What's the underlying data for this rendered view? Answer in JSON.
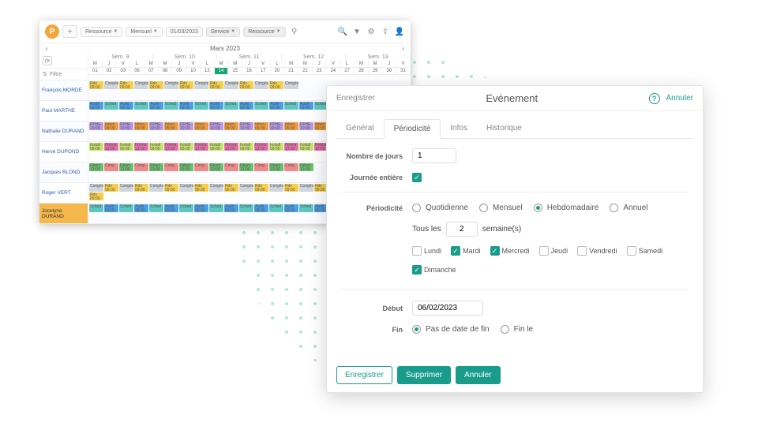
{
  "toolbar": {
    "add": "＋",
    "resource": "Ressource",
    "view": "Mensuel",
    "date": "01/03/2023",
    "service": "Service",
    "resource2": "Ressource"
  },
  "calendar": {
    "month": "Mars 2023",
    "filter": "Filtre",
    "weeks": [
      "Sem. 9",
      "Sem. 10",
      "Sem. 11",
      "Sem. 12",
      "Sem. 13"
    ],
    "dayletters": [
      "M",
      "J",
      "V",
      "L",
      "M",
      "M",
      "J",
      "V",
      "L",
      "M",
      "M",
      "J",
      "V",
      "L",
      "M",
      "M",
      "J",
      "V",
      "L",
      "M",
      "M",
      "J",
      "V"
    ],
    "daynums": [
      "01",
      "02",
      "03",
      "06",
      "07",
      "08",
      "09",
      "10",
      "13",
      "14",
      "15",
      "16",
      "17",
      "20",
      "21",
      "22",
      "23",
      "24",
      "27",
      "28",
      "29",
      "30",
      "31"
    ],
    "highlight_index": 9,
    "resources": [
      {
        "name": "François MORDE",
        "hl": false
      },
      {
        "name": "Paul MARTHE",
        "hl": false
      },
      {
        "name": "Nathalie DURAND",
        "hl": false
      },
      {
        "name": "Hervé DUPOND",
        "hl": false
      },
      {
        "name": "Jacques BLOND",
        "hl": false
      },
      {
        "name": "Roger VERT",
        "hl": false
      },
      {
        "name": "Jocelyne DURAND",
        "hl": true
      }
    ],
    "event_samples": [
      {
        "c": "#f6cf4a",
        "t": "Rdv 09:00"
      },
      {
        "c": "#f29b3a",
        "t": "Interv 09:00"
      },
      {
        "c": "#69c06d",
        "t": "Réuni 13:00"
      },
      {
        "c": "#4aa0e8",
        "t": "Audit 09:00"
      },
      {
        "c": "#e96fa9",
        "t": "Forma 13:00"
      },
      {
        "c": "#cfd5da",
        "t": "Congés"
      },
      {
        "c": "#b999e6",
        "t": "PPHE 10:00"
      },
      {
        "c": "#f08a8a",
        "t": "Cong"
      },
      {
        "c": "#5ec6c0",
        "t": "Sched"
      },
      {
        "c": "#c7e36b",
        "t": "Install 09:00"
      }
    ]
  },
  "dialog": {
    "save_top": "Enregistrer",
    "title": "Evénement",
    "cancel": "Annuler",
    "tabs": {
      "general": "Général",
      "periodicite": "Périodicité",
      "infos": "Infos",
      "historique": "Historique"
    },
    "fields": {
      "nbjours_label": "Nombre de jours",
      "nbjours_value": "1",
      "journee_label": "Journée entière",
      "periodicite_label": "Périodicité",
      "period_opts": {
        "daily": "Quotidienne",
        "monthly": "Mensuel",
        "weekly": "Hebdomadaire",
        "yearly": "Annuel"
      },
      "period_selected": "weekly",
      "every_prefix": "Tous les",
      "every_value": "2",
      "every_suffix": "semaine(s)",
      "days": {
        "mon": "Lundi",
        "tue": "Mardi",
        "wed": "Mercredi",
        "thu": "Jeudi",
        "fri": "Vendredi",
        "sat": "Samedi",
        "sun": "Dimanche"
      },
      "days_checked": [
        "tue",
        "wed",
        "sun"
      ],
      "debut_label": "Début",
      "debut_value": "06/02/2023",
      "fin_label": "Fin",
      "fin_opts": {
        "none": "Pas de date de fin",
        "on": "Fin le"
      },
      "fin_selected": "none"
    },
    "buttons": {
      "save": "Enregistrer",
      "delete": "Supprimer",
      "cancel": "Annuler"
    }
  }
}
